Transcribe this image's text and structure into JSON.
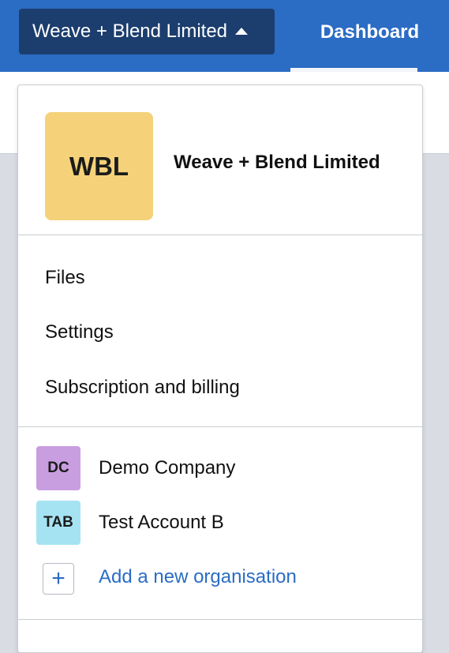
{
  "header": {
    "org_switcher_label": "Weave + Blend Limited",
    "tab_dashboard": "Dashboard"
  },
  "dropdown": {
    "current_org": {
      "initials": "WBL",
      "name": "Weave + Blend Limited",
      "logo_color": "#f5d279"
    },
    "menu": [
      {
        "label": "Files"
      },
      {
        "label": "Settings"
      },
      {
        "label": "Subscription and billing"
      }
    ],
    "organisations": [
      {
        "initials": "DC",
        "name": "Demo Company",
        "color": "#c99ee0"
      },
      {
        "initials": "TAB",
        "name": "Test Account B",
        "color": "#a6e3f2"
      }
    ],
    "add_org_label": "Add a new organisation",
    "add_icon": "plus-icon"
  },
  "colors": {
    "topbar": "#2b6cc4",
    "switcher_bg": "#1c3e6e",
    "link": "#2b6cc4"
  }
}
